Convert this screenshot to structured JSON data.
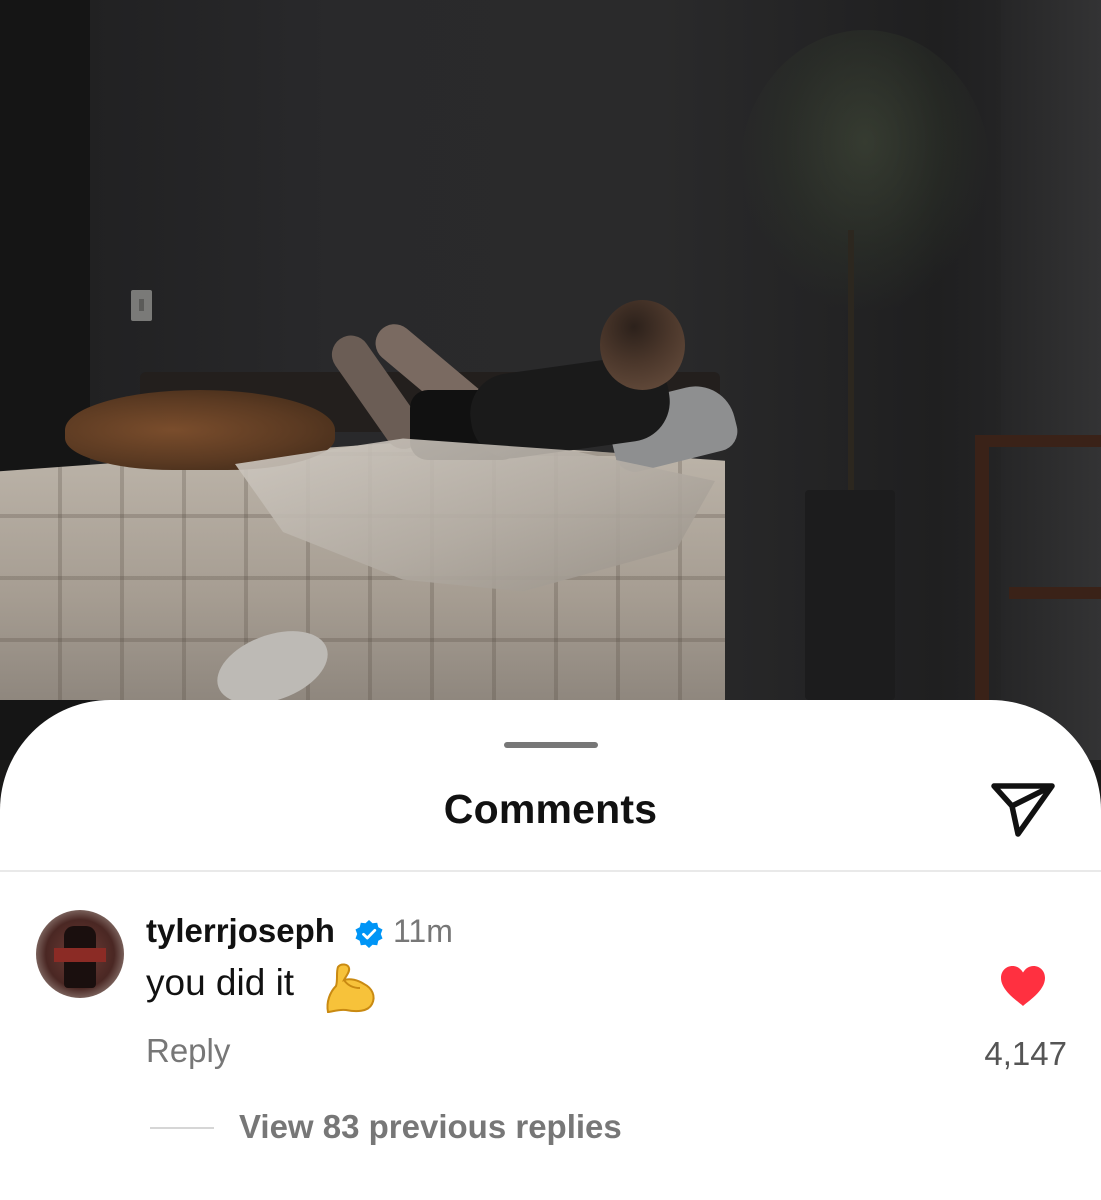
{
  "photo": {
    "description_icon": "photo-background"
  },
  "sheet": {
    "title": "Comments",
    "share_icon": "send-icon"
  },
  "comment": {
    "username": "tylerrjoseph",
    "verified": true,
    "time": "11m",
    "text": "you did it",
    "emoji_icon": "flexed-biceps-icon",
    "reply_label": "Reply",
    "liked": true,
    "like_count": "4,147",
    "view_replies_label": "View 83 previous replies"
  },
  "colors": {
    "heart": "#ff3040",
    "verified": "#0095f6",
    "secondary_text": "#777777"
  }
}
